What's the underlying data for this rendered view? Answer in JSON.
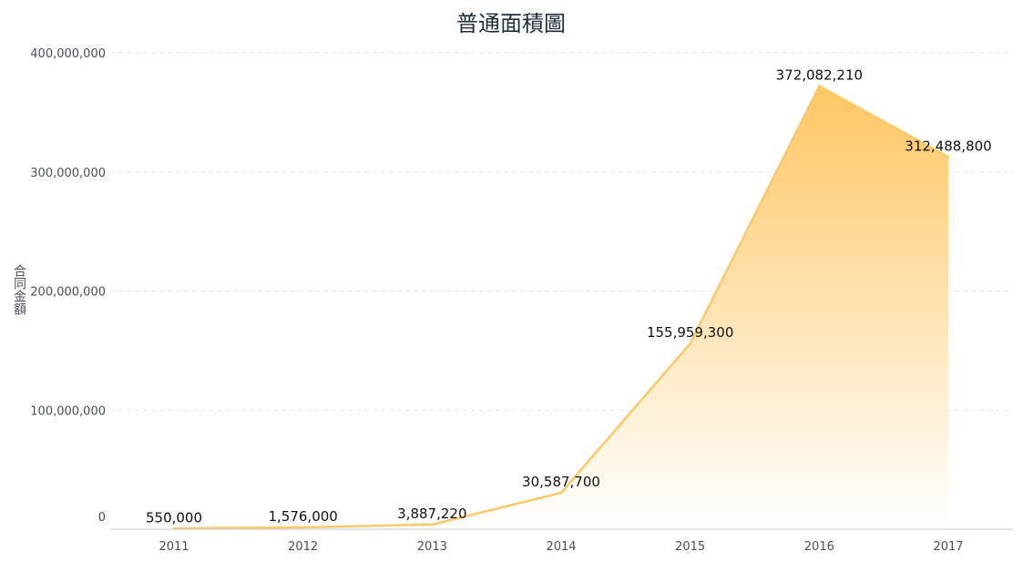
{
  "chart_data": {
    "type": "area",
    "title": "普通面積圖",
    "xlabel": "",
    "ylabel": "合同金額",
    "categories": [
      "2011",
      "2012",
      "2013",
      "2014",
      "2015",
      "2016",
      "2017"
    ],
    "series": [
      {
        "values": [
          550000,
          1576000,
          3887220,
          30587700,
          155959300,
          372082210,
          312488800
        ],
        "labels": [
          "550,000",
          "1,576,000",
          "3,887,220",
          "30,587,700",
          "155,959,300",
          "372,082,210",
          "312,488,800"
        ]
      }
    ],
    "y_ticks": [
      "0",
      "100,000,000",
      "200,000,000",
      "300,000,000",
      "400,000,000"
    ],
    "ylim": [
      0,
      400000000
    ],
    "grid": true,
    "colors": {
      "line": "#fac96a",
      "fill_top": "#ffc35a",
      "fill_bottom": "#ffffff",
      "grid": "#e3e3e3",
      "axis": "#c8c8c8"
    }
  }
}
